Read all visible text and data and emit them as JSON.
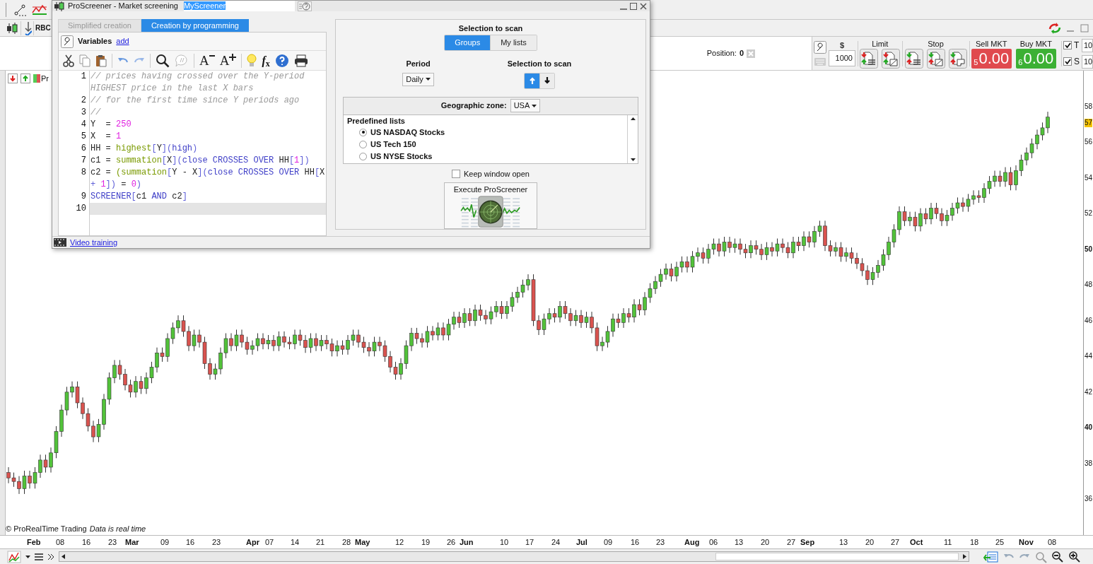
{
  "app_toolbar": {
    "instrument": "RBC",
    "chart_tab": "Pr"
  },
  "position": {
    "label": "Position:",
    "value": "0"
  },
  "order_panel": {
    "amount_label": "$",
    "amount": "1000",
    "limit_label": "Limit",
    "stop_label": "Stop",
    "market_buttons": [
      {
        "kind": "sell",
        "label": "Sell MKT",
        "quantity": "5",
        "price": "0.00"
      },
      {
        "kind": "buy",
        "label": "Buy MKT",
        "quantity": "6",
        "price": "0.00"
      }
    ],
    "options": [
      {
        "label": "T",
        "checked": true,
        "value": "10"
      },
      {
        "label": "S",
        "checked": true,
        "value": "10"
      }
    ]
  },
  "dialog": {
    "title": "ProScreener - Market screening",
    "screener_name": "MyScreener",
    "tabs": [
      {
        "label": "Simplified creation",
        "selected": false
      },
      {
        "label": "Creation by programming",
        "selected": true
      }
    ],
    "variables_label": "Variables",
    "add_link": "add",
    "editor_toolbar": {
      "font_decrease": "A",
      "font_increase": "A",
      "formula": "*f*$_{x}$"
    },
    "code_lines": [
      {
        "number": "1",
        "current": false,
        "tokens": [
          {
            "kind": "comment",
            "text": "// prices having crossed over the Y-period HIGHEST price in the last X bars"
          }
        ]
      },
      {
        "number": "2",
        "current": false,
        "tokens": [
          {
            "kind": "comment",
            "text": "// for the first time since Y periods ago"
          }
        ]
      },
      {
        "number": "3",
        "current": false,
        "tokens": [
          {
            "kind": "comment",
            "text": "//"
          }
        ]
      },
      {
        "number": "4",
        "current": false,
        "tokens": [
          {
            "kind": "plain",
            "text": "Y  = "
          },
          {
            "kind": "number",
            "text": "250"
          }
        ]
      },
      {
        "number": "5",
        "current": false,
        "tokens": [
          {
            "kind": "plain",
            "text": "X  = "
          },
          {
            "kind": "number",
            "text": "1"
          }
        ]
      },
      {
        "number": "6",
        "current": false,
        "tokens": [
          {
            "kind": "plain",
            "text": "HH = "
          },
          {
            "kind": "function",
            "text": "highest"
          },
          {
            "kind": "bracket",
            "text": "["
          },
          {
            "kind": "plain",
            "text": "Y"
          },
          {
            "kind": "bracket",
            "text": "]("
          },
          {
            "kind": "keyword",
            "text": "high"
          },
          {
            "kind": "bracket",
            "text": ")"
          }
        ]
      },
      {
        "number": "7",
        "current": false,
        "tokens": [
          {
            "kind": "plain",
            "text": "c1 = "
          },
          {
            "kind": "function",
            "text": "summation"
          },
          {
            "kind": "bracket",
            "text": "["
          },
          {
            "kind": "plain",
            "text": "X"
          },
          {
            "kind": "bracket",
            "text": "]("
          },
          {
            "kind": "keyword",
            "text": "close CROSSES OVER "
          },
          {
            "kind": "plain",
            "text": "HH"
          },
          {
            "kind": "bracket",
            "text": "["
          },
          {
            "kind": "number",
            "text": "1"
          },
          {
            "kind": "bracket",
            "text": "])"
          }
        ]
      },
      {
        "number": "8",
        "current": false,
        "tokens": [
          {
            "kind": "plain",
            "text": "c2 = "
          },
          {
            "kind": "function",
            "text": "(summation"
          },
          {
            "kind": "bracket",
            "text": "["
          },
          {
            "kind": "plain",
            "text": "Y - X"
          },
          {
            "kind": "bracket",
            "text": "]("
          },
          {
            "kind": "keyword",
            "text": "close CROSSES OVER "
          },
          {
            "kind": "plain",
            "text": "HH"
          },
          {
            "kind": "bracket",
            "text": "["
          },
          {
            "kind": "plain",
            "text": "X"
          },
          {
            "kind": "bracket",
            "text": " + "
          },
          {
            "kind": "number",
            "text": "1"
          },
          {
            "kind": "bracket",
            "text": "])"
          },
          {
            "kind": "plain",
            "text": " = "
          },
          {
            "kind": "number",
            "text": "0"
          },
          {
            "kind": "bracket",
            "text": ")"
          }
        ]
      },
      {
        "number": "9",
        "current": false,
        "tokens": [
          {
            "kind": "keyword",
            "text": "SCREENER"
          },
          {
            "kind": "bracket",
            "text": "["
          },
          {
            "kind": "plain",
            "text": "c1 "
          },
          {
            "kind": "keyword",
            "text": "AND"
          },
          {
            "kind": "plain",
            "text": " c2"
          },
          {
            "kind": "bracket",
            "text": "]"
          }
        ]
      },
      {
        "number": "10",
        "current": true
      }
    ],
    "scan": {
      "heading": "Selection to scan",
      "modes": [
        {
          "label": "Groups",
          "selected": true
        },
        {
          "label": "My lists",
          "selected": false
        }
      ],
      "period_label": "Period",
      "period": "Daily",
      "direction_label": "Selection to scan",
      "directions": [
        {
          "kind": "up",
          "selected": true
        },
        {
          "kind": "down",
          "selected": false
        }
      ],
      "zone_label": "Geographic zone:",
      "zone": "USA",
      "lists_heading": "Predefined lists",
      "lists": [
        {
          "label": "US NASDAQ Stocks",
          "selected": true
        },
        {
          "label": "US Tech 150",
          "selected": false
        },
        {
          "label": "US NYSE Stocks",
          "selected": false
        }
      ],
      "keep_open": {
        "label": "Keep window open",
        "checked": false
      },
      "execute_label": "Execute ProScreener"
    },
    "video_link": "Video training"
  },
  "chart": {
    "date_labels": [
      {
        "text": "Feb",
        "kind": "month"
      },
      {
        "text": "08",
        "kind": "day"
      },
      {
        "text": "16",
        "kind": "day"
      },
      {
        "text": "23",
        "kind": "day"
      },
      {
        "text": "Mar",
        "kind": "month"
      },
      {
        "text": "09",
        "kind": "day"
      },
      {
        "text": "16",
        "kind": "day"
      },
      {
        "text": "23",
        "kind": "day"
      },
      {
        "text": "Apr",
        "kind": "month"
      },
      {
        "text": "07",
        "kind": "day"
      },
      {
        "text": "14",
        "kind": "day"
      },
      {
        "text": "21",
        "kind": "day"
      },
      {
        "text": "28",
        "kind": "day"
      },
      {
        "text": "May",
        "kind": "month"
      },
      {
        "text": "12",
        "kind": "day"
      },
      {
        "text": "19",
        "kind": "day"
      },
      {
        "text": "26",
        "kind": "day"
      },
      {
        "text": "Jun",
        "kind": "month"
      },
      {
        "text": "10",
        "kind": "day"
      },
      {
        "text": "17",
        "kind": "day"
      },
      {
        "text": "24",
        "kind": "day"
      },
      {
        "text": "Jul",
        "kind": "month"
      },
      {
        "text": "09",
        "kind": "day"
      },
      {
        "text": "16",
        "kind": "day"
      },
      {
        "text": "23",
        "kind": "day"
      },
      {
        "text": "Aug",
        "kind": "month"
      },
      {
        "text": "06",
        "kind": "day"
      },
      {
        "text": "13",
        "kind": "day"
      },
      {
        "text": "20",
        "kind": "day"
      },
      {
        "text": "27",
        "kind": "day"
      },
      {
        "text": "Sep",
        "kind": "month"
      },
      {
        "text": "13",
        "kind": "day"
      },
      {
        "text": "20",
        "kind": "day"
      },
      {
        "text": "27",
        "kind": "day"
      },
      {
        "text": "Oct",
        "kind": "month"
      },
      {
        "text": "11",
        "kind": "day"
      },
      {
        "text": "18",
        "kind": "day"
      },
      {
        "text": "25",
        "kind": "day"
      },
      {
        "text": "Nov",
        "kind": "month"
      },
      {
        "text": "08",
        "kind": "day"
      }
    ],
    "current_price": "57",
    "copyright": "© ProRealTime Trading",
    "data_note": "Data is real time",
    "chart_data": {
      "type": "candlestick",
      "ylim": [
        34,
        60
      ],
      "yticks": [
        {
          "value": 58,
          "label": "58"
        },
        {
          "value": 56,
          "label": "56"
        },
        {
          "value": 54,
          "label": "54"
        },
        {
          "value": 52,
          "label": "52"
        },
        {
          "value": 50,
          "label": "50"
        },
        {
          "value": 48,
          "label": "48"
        },
        {
          "value": 46,
          "label": "46"
        },
        {
          "value": 44,
          "label": "44"
        },
        {
          "value": 42,
          "label": "42"
        },
        {
          "value": 40,
          "label": "40"
        },
        {
          "value": 38,
          "label": "38"
        },
        {
          "value": 36,
          "label": "36"
        }
      ],
      "categories": [
        null,
        null,
        null,
        null,
        null,
        null,
        null,
        null,
        null,
        null,
        null,
        null,
        null,
        null,
        null,
        null,
        null,
        null,
        null,
        null,
        null,
        null,
        null,
        null,
        null,
        null,
        null,
        null,
        null,
        null,
        null,
        null,
        null,
        null,
        null,
        null,
        null,
        null,
        null,
        null,
        null,
        null,
        null,
        null,
        null,
        null,
        null,
        null,
        null,
        null,
        null,
        null,
        null,
        null,
        null,
        null,
        null,
        null,
        null,
        null,
        null,
        null,
        null,
        null,
        null,
        null,
        null,
        null,
        null,
        null,
        null,
        null,
        null,
        null,
        null,
        null,
        null,
        null,
        null,
        null,
        null,
        null,
        null,
        null,
        null,
        null,
        null,
        null,
        null,
        null,
        null,
        null,
        null,
        null,
        null,
        null,
        null,
        null,
        null,
        null,
        null,
        null,
        null,
        null,
        null,
        null,
        null,
        null,
        null,
        null,
        null,
        null,
        null,
        null,
        null,
        null,
        null,
        null,
        null,
        null,
        null,
        null,
        null,
        null,
        null,
        null,
        null,
        null,
        null,
        null,
        null,
        null,
        null,
        null,
        null,
        null,
        null,
        null,
        null,
        null,
        null,
        null,
        null,
        null,
        null,
        null,
        null,
        null,
        null,
        null,
        null,
        null,
        null,
        null,
        null,
        null,
        null,
        null,
        null,
        null,
        null,
        null,
        null,
        null,
        null,
        null,
        null,
        null,
        null,
        null,
        null,
        null,
        null,
        null,
        null,
        null,
        null,
        null,
        null,
        null,
        null,
        null,
        null,
        null,
        null,
        null,
        null,
        null,
        null,
        null,
        null,
        null,
        null,
        null,
        null,
        null,
        null
      ],
      "ohlc": [
        [
          37.5,
          37.8,
          36.9,
          37.2
        ],
        [
          37.2,
          37.5,
          36.7,
          37.0
        ],
        [
          37.0,
          37.3,
          36.3,
          36.6
        ],
        [
          36.6,
          37.6,
          36.3,
          37.3
        ],
        [
          37.3,
          37.6,
          36.6,
          36.9
        ],
        [
          36.9,
          37.8,
          36.6,
          37.5
        ],
        [
          37.5,
          38.5,
          37.2,
          38.2
        ],
        [
          38.2,
          38.5,
          37.5,
          37.8
        ],
        [
          37.8,
          38.9,
          37.5,
          38.6
        ],
        [
          38.6,
          40.1,
          38.3,
          39.8
        ],
        [
          39.8,
          41.3,
          39.5,
          41.0
        ],
        [
          41.0,
          42.3,
          40.7,
          42.0
        ],
        [
          42.0,
          42.6,
          41.7,
          42.3
        ],
        [
          42.3,
          42.6,
          41.1,
          41.4
        ],
        [
          41.4,
          41.7,
          40.5,
          40.8
        ],
        [
          40.8,
          41.1,
          39.8,
          40.1
        ],
        [
          40.1,
          40.4,
          39.2,
          39.5
        ],
        [
          39.5,
          40.5,
          39.2,
          40.2
        ],
        [
          40.2,
          41.9,
          39.9,
          41.6
        ],
        [
          41.6,
          43.1,
          41.3,
          42.8
        ],
        [
          42.8,
          43.8,
          42.5,
          43.5
        ],
        [
          43.5,
          43.8,
          42.7,
          43.0
        ],
        [
          43.0,
          43.3,
          42.1,
          42.4
        ],
        [
          42.4,
          42.7,
          41.7,
          42.0
        ],
        [
          42.0,
          42.9,
          41.7,
          42.6
        ],
        [
          42.6,
          42.9,
          41.9,
          42.2
        ],
        [
          42.2,
          43.1,
          41.9,
          42.8
        ],
        [
          42.8,
          43.7,
          42.5,
          43.4
        ],
        [
          43.4,
          44.5,
          43.1,
          44.2
        ],
        [
          44.2,
          44.5,
          43.7,
          44.0
        ],
        [
          44.0,
          45.3,
          43.7,
          45.0
        ],
        [
          45.0,
          45.9,
          44.7,
          45.6
        ],
        [
          45.6,
          46.3,
          45.3,
          46.0
        ],
        [
          46.0,
          46.3,
          45.1,
          45.4
        ],
        [
          45.4,
          45.7,
          44.3,
          44.6
        ],
        [
          44.6,
          45.5,
          44.3,
          45.2
        ],
        [
          45.2,
          45.5,
          44.5,
          44.8
        ],
        [
          44.8,
          45.1,
          43.3,
          43.6
        ],
        [
          43.6,
          43.9,
          42.7,
          43.0
        ],
        [
          43.0,
          43.6,
          42.7,
          43.3
        ],
        [
          43.3,
          44.5,
          43.0,
          44.2
        ],
        [
          44.2,
          45.3,
          43.9,
          45.0
        ],
        [
          45.0,
          45.3,
          44.3,
          44.6
        ],
        [
          44.6,
          45.5,
          44.3,
          45.2
        ],
        [
          45.2,
          45.5,
          44.5,
          44.8
        ],
        [
          44.8,
          45.1,
          44.1,
          44.4
        ],
        [
          44.4,
          44.9,
          44.1,
          44.6
        ],
        [
          44.6,
          45.3,
          44.3,
          45.0
        ],
        [
          45.0,
          45.3,
          44.4,
          44.7
        ],
        [
          44.7,
          45.2,
          44.4,
          44.9
        ],
        [
          44.9,
          45.2,
          44.3,
          44.6
        ],
        [
          44.6,
          45.4,
          44.3,
          45.1
        ],
        [
          45.1,
          45.4,
          44.5,
          44.8
        ],
        [
          44.8,
          45.1,
          44.4,
          44.7
        ],
        [
          44.7,
          45.5,
          44.4,
          45.2
        ],
        [
          45.2,
          45.5,
          44.6,
          44.9
        ],
        [
          44.9,
          45.2,
          44.2,
          44.5
        ],
        [
          44.5,
          45.3,
          44.2,
          45.0
        ],
        [
          45.0,
          45.3,
          44.3,
          44.6
        ],
        [
          44.6,
          45.2,
          44.3,
          44.9
        ],
        [
          44.9,
          45.2,
          44.4,
          44.7
        ],
        [
          44.7,
          45.0,
          44.0,
          44.3
        ],
        [
          44.3,
          44.9,
          44.0,
          44.6
        ],
        [
          44.6,
          44.9,
          44.1,
          44.4
        ],
        [
          44.4,
          45.2,
          44.1,
          44.9
        ],
        [
          44.9,
          45.5,
          44.6,
          45.2
        ],
        [
          45.2,
          45.5,
          44.5,
          44.8
        ],
        [
          44.8,
          45.1,
          44.2,
          44.5
        ],
        [
          44.5,
          44.8,
          44.0,
          44.3
        ],
        [
          44.3,
          45.1,
          44.0,
          44.8
        ],
        [
          44.8,
          45.1,
          44.3,
          44.6
        ],
        [
          44.6,
          44.9,
          43.7,
          44.0
        ],
        [
          44.0,
          44.3,
          43.1,
          43.4
        ],
        [
          43.4,
          43.7,
          42.7,
          43.0
        ],
        [
          43.0,
          43.9,
          42.7,
          43.6
        ],
        [
          43.6,
          44.9,
          43.3,
          44.6
        ],
        [
          44.6,
          45.6,
          44.3,
          45.3
        ],
        [
          45.3,
          45.6,
          44.7,
          45.0
        ],
        [
          45.0,
          45.3,
          44.5,
          44.8
        ],
        [
          44.8,
          45.7,
          44.5,
          45.4
        ],
        [
          45.4,
          45.7,
          44.9,
          45.2
        ],
        [
          45.2,
          45.9,
          44.9,
          45.6
        ],
        [
          45.6,
          45.9,
          44.9,
          45.2
        ],
        [
          45.2,
          46.1,
          44.9,
          45.8
        ],
        [
          45.8,
          46.5,
          45.5,
          46.2
        ],
        [
          46.2,
          46.5,
          45.6,
          45.9
        ],
        [
          45.9,
          46.7,
          45.6,
          46.4
        ],
        [
          46.4,
          46.7,
          45.7,
          46.0
        ],
        [
          46.0,
          46.9,
          45.7,
          46.6
        ],
        [
          46.6,
          46.9,
          46.0,
          46.3
        ],
        [
          46.3,
          46.6,
          45.8,
          46.1
        ],
        [
          46.1,
          46.8,
          45.8,
          46.5
        ],
        [
          46.5,
          47.1,
          46.2,
          46.8
        ],
        [
          46.8,
          47.1,
          46.1,
          46.4
        ],
        [
          46.4,
          47.1,
          46.1,
          46.8
        ],
        [
          46.8,
          47.6,
          46.5,
          47.3
        ],
        [
          47.3,
          47.9,
          47.0,
          47.6
        ],
        [
          47.6,
          48.3,
          47.3,
          48.0
        ],
        [
          48.0,
          48.6,
          47.7,
          48.3
        ],
        [
          48.3,
          48.6,
          45.7,
          46.0
        ],
        [
          46.0,
          46.3,
          45.2,
          45.5
        ],
        [
          45.5,
          46.4,
          45.2,
          46.1
        ],
        [
          46.1,
          46.7,
          45.8,
          46.4
        ],
        [
          46.4,
          46.7,
          45.9,
          46.2
        ],
        [
          46.2,
          47.1,
          45.9,
          46.8
        ],
        [
          46.8,
          47.1,
          46.1,
          46.4
        ],
        [
          46.4,
          46.7,
          45.7,
          46.0
        ],
        [
          46.0,
          46.6,
          45.7,
          46.3
        ],
        [
          46.3,
          46.6,
          45.6,
          45.9
        ],
        [
          45.9,
          46.5,
          45.6,
          46.2
        ],
        [
          46.2,
          46.5,
          45.3,
          45.6
        ],
        [
          45.6,
          45.9,
          44.3,
          44.6
        ],
        [
          44.6,
          45.1,
          44.3,
          44.8
        ],
        [
          44.8,
          45.7,
          44.5,
          45.4
        ],
        [
          45.4,
          46.4,
          45.1,
          46.1
        ],
        [
          46.1,
          46.4,
          45.6,
          45.9
        ],
        [
          45.9,
          46.7,
          45.6,
          46.4
        ],
        [
          46.4,
          46.7,
          45.9,
          46.2
        ],
        [
          46.2,
          47.2,
          45.9,
          46.9
        ],
        [
          46.9,
          47.2,
          46.3,
          46.6
        ],
        [
          46.6,
          47.6,
          46.3,
          47.3
        ],
        [
          47.3,
          48.1,
          47.0,
          47.8
        ],
        [
          47.8,
          48.5,
          47.5,
          48.2
        ],
        [
          48.2,
          48.9,
          47.9,
          48.6
        ],
        [
          48.6,
          49.2,
          48.3,
          48.9
        ],
        [
          48.9,
          49.2,
          48.2,
          48.5
        ],
        [
          48.5,
          49.3,
          48.2,
          49.0
        ],
        [
          49.0,
          49.6,
          48.7,
          49.3
        ],
        [
          49.3,
          49.6,
          48.7,
          49.0
        ],
        [
          49.0,
          49.9,
          48.7,
          49.6
        ],
        [
          49.6,
          50.1,
          49.3,
          49.8
        ],
        [
          49.8,
          50.1,
          49.2,
          49.5
        ],
        [
          49.5,
          50.3,
          49.2,
          50.0
        ],
        [
          50.0,
          50.6,
          49.7,
          50.3
        ],
        [
          50.3,
          50.6,
          49.6,
          49.9
        ],
        [
          49.9,
          50.7,
          49.6,
          50.4
        ],
        [
          50.4,
          50.7,
          49.8,
          50.1
        ],
        [
          50.1,
          50.6,
          49.8,
          50.3
        ],
        [
          50.3,
          50.6,
          49.7,
          50.0
        ],
        [
          50.0,
          50.3,
          49.5,
          49.8
        ],
        [
          49.8,
          50.5,
          49.5,
          50.2
        ],
        [
          50.2,
          50.5,
          49.7,
          50.0
        ],
        [
          50.0,
          50.3,
          49.4,
          49.7
        ],
        [
          49.7,
          50.4,
          49.4,
          50.1
        ],
        [
          50.1,
          50.4,
          49.6,
          49.9
        ],
        [
          49.9,
          50.6,
          49.6,
          50.3
        ],
        [
          50.3,
          50.6,
          49.8,
          50.1
        ],
        [
          50.1,
          50.4,
          49.5,
          49.8
        ],
        [
          49.8,
          50.7,
          49.5,
          50.4
        ],
        [
          50.4,
          50.7,
          49.9,
          50.2
        ],
        [
          50.2,
          51.0,
          49.9,
          50.7
        ],
        [
          50.7,
          51.0,
          50.1,
          50.4
        ],
        [
          50.4,
          51.3,
          50.1,
          51.0
        ],
        [
          51.0,
          51.6,
          50.7,
          51.3
        ],
        [
          51.3,
          51.6,
          49.9,
          50.2
        ],
        [
          50.2,
          50.5,
          49.6,
          49.9
        ],
        [
          49.9,
          50.4,
          49.6,
          50.1
        ],
        [
          50.1,
          50.4,
          49.3,
          49.6
        ],
        [
          49.6,
          50.1,
          49.3,
          49.8
        ],
        [
          49.8,
          50.1,
          49.2,
          49.5
        ],
        [
          49.5,
          49.8,
          48.9,
          49.2
        ],
        [
          49.2,
          49.5,
          48.5,
          48.8
        ],
        [
          48.8,
          49.1,
          48.0,
          48.3
        ],
        [
          48.3,
          49.0,
          48.0,
          48.7
        ],
        [
          48.7,
          49.4,
          48.4,
          49.1
        ],
        [
          49.1,
          50.0,
          48.8,
          49.7
        ],
        [
          49.7,
          50.7,
          49.4,
          50.4
        ],
        [
          50.4,
          51.4,
          50.1,
          51.1
        ],
        [
          51.1,
          52.4,
          50.8,
          52.1
        ],
        [
          52.1,
          52.4,
          51.3,
          51.6
        ],
        [
          51.6,
          52.1,
          51.3,
          51.8
        ],
        [
          51.8,
          52.1,
          51.0,
          51.3
        ],
        [
          51.3,
          52.3,
          51.0,
          52.0
        ],
        [
          52.0,
          52.3,
          51.4,
          51.7
        ],
        [
          51.7,
          52.6,
          51.4,
          52.3
        ],
        [
          52.3,
          52.6,
          51.7,
          52.0
        ],
        [
          52.0,
          52.3,
          51.3,
          51.6
        ],
        [
          51.6,
          52.2,
          51.3,
          51.9
        ],
        [
          51.9,
          52.6,
          51.6,
          52.3
        ],
        [
          52.3,
          52.9,
          52.0,
          52.6
        ],
        [
          52.6,
          52.9,
          52.1,
          52.4
        ],
        [
          52.4,
          53.1,
          52.1,
          52.8
        ],
        [
          52.8,
          53.3,
          52.5,
          53.0
        ],
        [
          53.0,
          53.3,
          52.6,
          52.9
        ],
        [
          52.9,
          53.7,
          52.6,
          53.4
        ],
        [
          53.4,
          54.1,
          53.1,
          53.8
        ],
        [
          53.8,
          54.4,
          53.5,
          54.1
        ],
        [
          54.1,
          54.4,
          53.5,
          53.8
        ],
        [
          53.8,
          54.6,
          53.5,
          54.3
        ],
        [
          54.3,
          54.6,
          53.3,
          53.6
        ],
        [
          53.6,
          54.7,
          53.3,
          54.4
        ],
        [
          54.4,
          55.3,
          54.1,
          55.0
        ],
        [
          55.0,
          55.7,
          54.7,
          55.4
        ],
        [
          55.4,
          56.2,
          55.1,
          55.9
        ],
        [
          55.9,
          56.7,
          55.6,
          56.4
        ],
        [
          56.4,
          57.1,
          56.1,
          56.8
        ],
        [
          56.8,
          57.7,
          56.5,
          57.4
        ]
      ]
    }
  }
}
